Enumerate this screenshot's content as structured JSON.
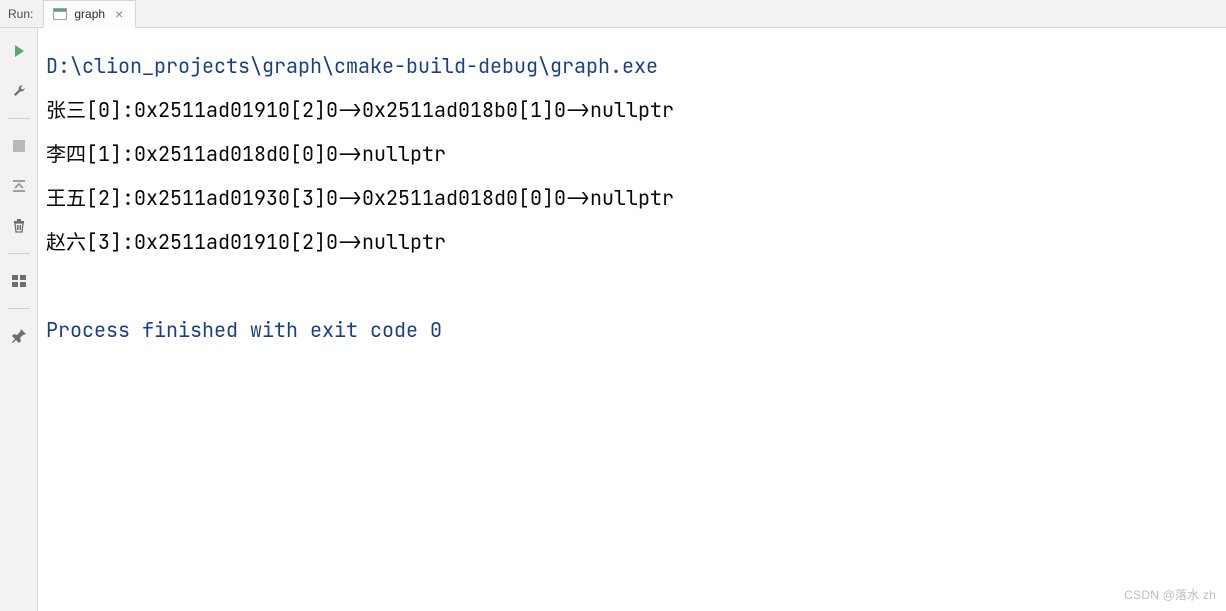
{
  "topbar": {
    "run_label": "Run:",
    "tab": {
      "label": "graph"
    }
  },
  "toolbar": {
    "items": [
      {
        "name": "run-icon"
      },
      {
        "name": "wrench-icon"
      },
      {
        "name": "stop-icon"
      },
      {
        "name": "scroll-to-top-icon"
      },
      {
        "name": "trash-icon"
      },
      {
        "name": "layout-icon"
      },
      {
        "name": "pin-icon"
      }
    ]
  },
  "console": {
    "command_path": "D:\\clion_projects\\graph\\cmake-build-debug\\graph.exe",
    "lines": [
      "张三[0]:0x2511ad01910[2]0->0x2511ad018b0[1]0->nullptr",
      "李四[1]:0x2511ad018d0[0]0->nullptr",
      "王五[2]:0x2511ad01930[3]0->0x2511ad018d0[0]0->nullptr",
      "赵六[3]:0x2511ad01910[2]0->nullptr"
    ],
    "exit_message": "Process finished with exit code 0"
  },
  "watermark": "CSDN @落水 zh"
}
